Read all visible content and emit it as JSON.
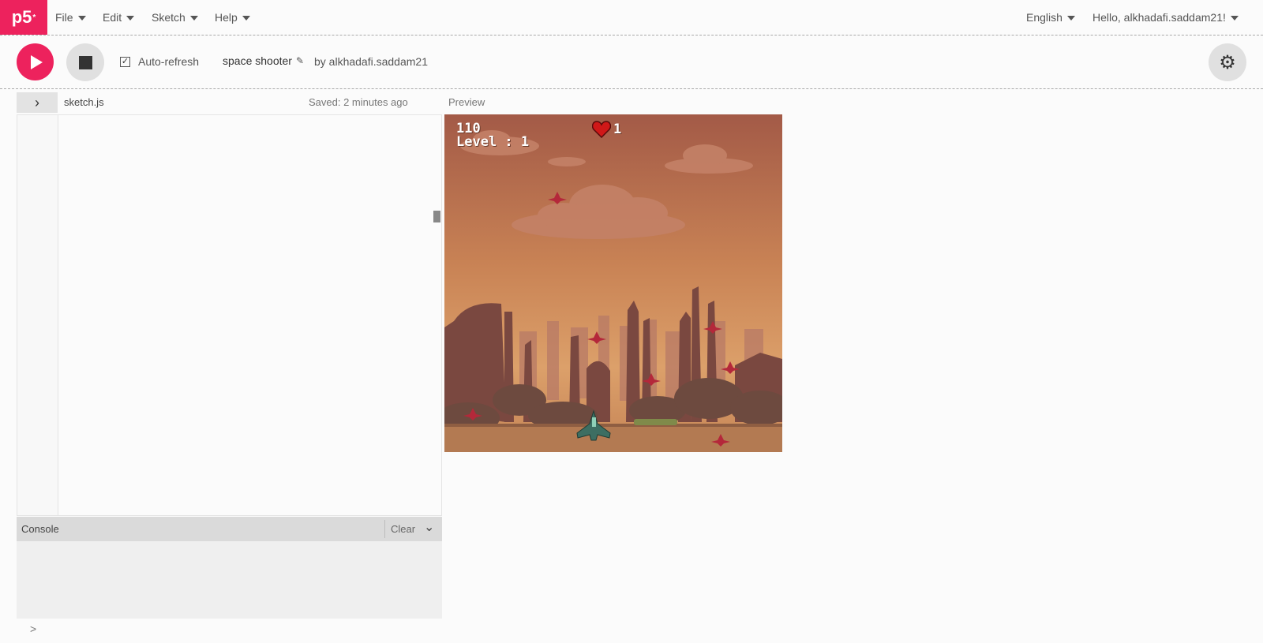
{
  "nav": {
    "logo": "p5",
    "logo_star": "*",
    "menus": [
      "File",
      "Edit",
      "Sketch",
      "Help"
    ],
    "language": "English",
    "user": "Hello, alkhadafi.saddam21!"
  },
  "toolbar": {
    "auto_refresh_label": "Auto-refresh",
    "auto_refresh_checked": true,
    "check_mark": "✓",
    "sketch_name": "space shooter",
    "author": "by alkhadafi.saddam21"
  },
  "editor": {
    "file_name": "sketch.js",
    "saved_status": "Saved: 2 minutes ago",
    "preview_label": "Preview"
  },
  "console": {
    "title": "Console",
    "clear_label": "Clear",
    "prompt": ">"
  },
  "game": {
    "score": "110",
    "level": "Level : 1",
    "lives": "1"
  },
  "colors": {
    "accent": "#ed225d",
    "sky_top": "#a8604a",
    "sky_bottom": "#d99a62",
    "ground": "#b07a52"
  },
  "icons": {
    "play": "play-icon",
    "stop": "stop-icon",
    "settings": "gear-icon",
    "files_toggle": "chevron-right-icon",
    "console_toggle": "chevron-down-icon",
    "edit": "pencil-icon",
    "heart": "heart-icon"
  }
}
